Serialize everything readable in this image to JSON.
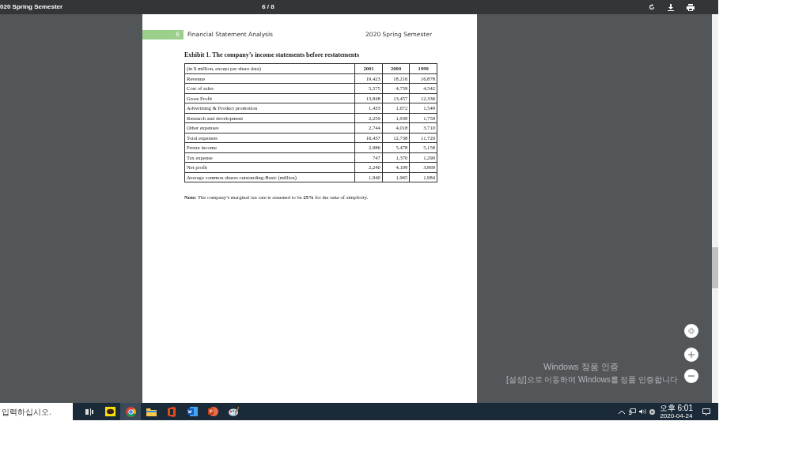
{
  "toolbar": {
    "title": "020 Spring Semester",
    "page_indicator": "6 / 8"
  },
  "page": {
    "header": {
      "page_number": "6",
      "left": "Financial Statement Analysis",
      "right": "2020 Spring Semester"
    },
    "exhibit_title": "Exhibit 1. The company’s income statements before restatements",
    "table": {
      "columns": [
        "(in $ million, except per share data)",
        "2001",
        "2000",
        "1999"
      ],
      "rows": [
        [
          "Revenue",
          "19,423",
          "18,216",
          "16,878"
        ],
        [
          "Cost of sales",
          "5,575",
          "4,759",
          "4,542"
        ],
        [
          "Gross Profit",
          "13,848",
          "13,457",
          "12,336"
        ],
        [
          "Advertising & Product promotion",
          "1,433",
          "1,672",
          "1,549"
        ],
        [
          "Research and development",
          "2,259",
          "1,939",
          "1,759"
        ],
        [
          "Other expenses",
          "2,744",
          "4,018",
          "3,710"
        ],
        [
          "Total expenses",
          "16,437",
          "12,738",
          "11,720"
        ],
        [
          "Pretax income",
          "2,986",
          "5,478",
          "5,158"
        ],
        [
          "Tax expense",
          "747",
          "1,370",
          "1,290"
        ],
        [
          "Net profit",
          "2,240",
          "4,109",
          "3,869"
        ],
        [
          "Average common shares outstanding-Basic (million)",
          "1,940",
          "1,965",
          "1,984"
        ]
      ]
    },
    "note": "**Note:** The company’s marginal tax rate is assumed to be **25%** for the sake of simplicity."
  },
  "activation_notice": {
    "title": "Windows 정품 인증",
    "message": "[설정]으로 이동하여 Windows를 정품 인증합니다"
  },
  "taskbar": {
    "search_placeholder": "입력하십시오.",
    "time": "오후 6:01",
    "date": "2020-04-24"
  }
}
